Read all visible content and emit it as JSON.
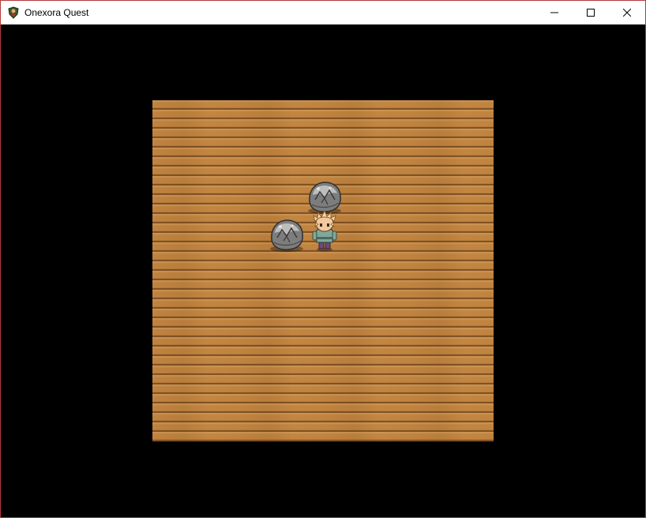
{
  "window": {
    "title": "Onexora Quest",
    "icons": {
      "app": "shield-hero-icon",
      "minimize": "minimize-icon",
      "maximize": "maximize-icon",
      "close": "close-icon"
    }
  },
  "colors": {
    "floor": "#c08340",
    "plank_line": "#3c1e05",
    "background": "#000000",
    "window_border": "#b43a3a"
  },
  "scene": {
    "map": "wooden-floor-room",
    "objects": [
      {
        "type": "boulder",
        "icon": "boulder-icon"
      },
      {
        "type": "boulder",
        "icon": "boulder-icon"
      },
      {
        "type": "player",
        "icon": "hero-sprite-icon",
        "facing": "down"
      }
    ]
  }
}
